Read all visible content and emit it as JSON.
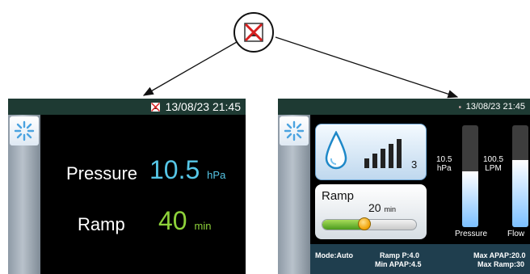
{
  "callout": {
    "icon": "humidifier-off-icon"
  },
  "screen_left": {
    "status": {
      "date_time": "13/08/23  21:45",
      "status_icon": "humidifier-off-icon"
    },
    "menu_icon": "snowflake-menu-icon",
    "pressure": {
      "label": "Pressure",
      "value": "10.5",
      "unit": "hPa",
      "color": "#56c6e6"
    },
    "ramp": {
      "label": "Ramp",
      "value": "40",
      "unit": "min",
      "color": "#8ed23a"
    }
  },
  "screen_right": {
    "status": {
      "date_time": "13/08/23  21:45",
      "status_icon": "humidifier-off-icon"
    },
    "menu_icon": "snowflake-menu-icon",
    "humidifier": {
      "icon": "water-drop-icon",
      "signal_icon": "signal-bars-icon",
      "level": "3"
    },
    "ramp": {
      "title": "Ramp",
      "value": "20",
      "unit": "min",
      "slider_level": 0.45
    },
    "pressure_gauge": {
      "value": "10.5",
      "unit": "hPa",
      "caption": "Pressure",
      "fill_level": 0.55
    },
    "flow_gauge": {
      "value": "100.5",
      "unit": "LPM",
      "caption": "Flow",
      "fill_level": 0.66
    },
    "bottom": {
      "mode": "Mode:Auto",
      "ramp_p": "Ramp P:4.0",
      "min_apap": "Min APAP:4.5",
      "max_apap": "Max APAP:20.0",
      "max_ramp": "Max Ramp:30"
    }
  }
}
